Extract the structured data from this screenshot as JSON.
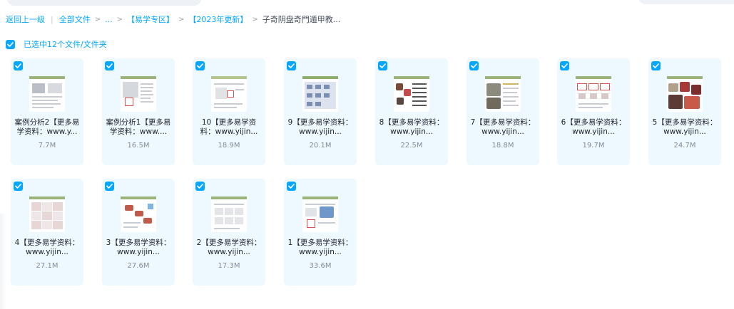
{
  "breadcrumb": {
    "back": "返回上一级",
    "all_files": "全部文件",
    "ellipsis": "...",
    "folder1": "【易学专区】",
    "folder2": "【2023年更新】",
    "current": "子奇阴盘奇門遁甲教..."
  },
  "selection": {
    "text": "已选中12个文件/文件夹"
  },
  "files": [
    {
      "name": "案例分析2【更多易学资料：www.y...",
      "size": "7.7M"
    },
    {
      "name": "案例分析1【更多易学资料：www....",
      "size": "16.5M"
    },
    {
      "name": "10【更多易学资料：www.yijin...",
      "size": "18.9M"
    },
    {
      "name": "9【更多易学资料：www.yijin...",
      "size": "20.1M"
    },
    {
      "name": "8【更多易学资料：www.yijin...",
      "size": "22.5M"
    },
    {
      "name": "7【更多易学资料：www.yijin...",
      "size": "18.8M"
    },
    {
      "name": "6【更多易学资料：www.yijin...",
      "size": "19.7M"
    },
    {
      "name": "5【更多易学资料：www.yijin...",
      "size": "24.7M"
    },
    {
      "name": "4【更多易学资料：www.yijin...",
      "size": "27.1M"
    },
    {
      "name": "3【更多易学资料：www.yijin...",
      "size": "27.6M"
    },
    {
      "name": "2【更多易学资料：www.yijin...",
      "size": "17.3M"
    },
    {
      "name": "1【更多易学资料：www.yijin...",
      "size": "33.6M"
    }
  ],
  "colors": {
    "accent": "#06a7ff",
    "card_bg": "#eef8ff"
  }
}
